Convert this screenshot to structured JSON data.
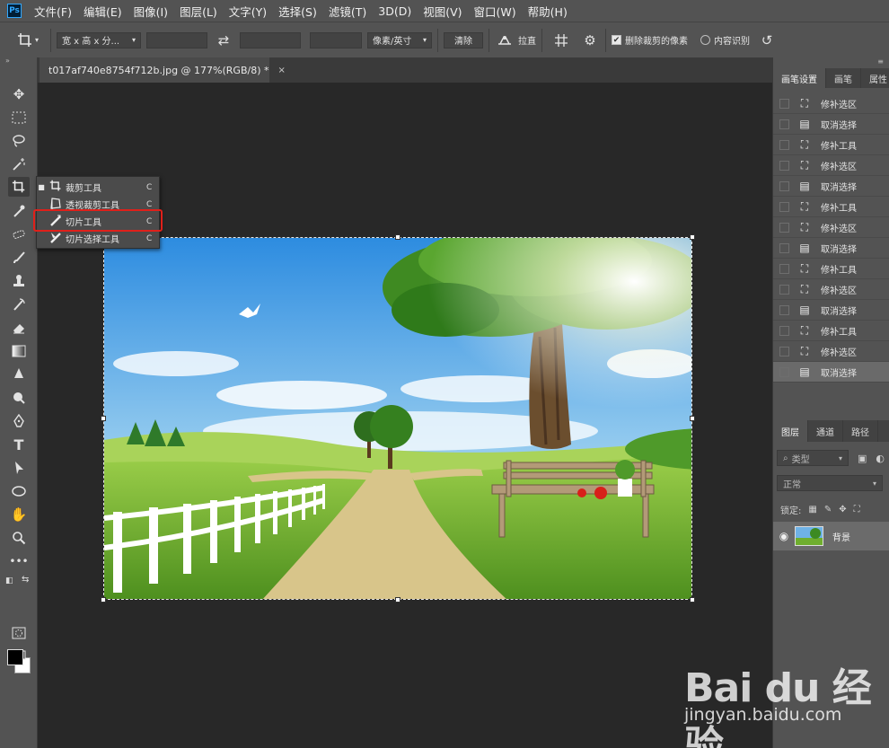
{
  "app": {
    "logo": "Ps"
  },
  "menu": [
    "文件(F)",
    "编辑(E)",
    "图像(I)",
    "图层(L)",
    "文字(Y)",
    "选择(S)",
    "滤镜(T)",
    "3D(D)",
    "视图(V)",
    "窗口(W)",
    "帮助(H)"
  ],
  "options": {
    "ratio_preset": "宽 x 高 x 分...",
    "resolution_unit": "像素/英寸",
    "clear_label": "清除",
    "straighten_label": "拉直",
    "delete_cropped_label": "删除裁剪的像素",
    "delete_cropped_checked": true,
    "content_aware_label": "内容识别",
    "content_aware_checked": false
  },
  "document": {
    "tab_title": "t017af740e8754f712b.jpg @ 177%(RGB/8) *",
    "close": "×"
  },
  "flyout": {
    "items": [
      {
        "label": "裁剪工具",
        "shortcut": "C",
        "current": true
      },
      {
        "label": "透视裁剪工具",
        "shortcut": "C",
        "current": false
      },
      {
        "label": "切片工具",
        "shortcut": "C",
        "current": false
      },
      {
        "label": "切片选择工具",
        "shortcut": "C",
        "current": false
      }
    ],
    "highlighted_index": 2
  },
  "right_panel": {
    "top_tabs": [
      "画笔设置",
      "画笔",
      "属性"
    ],
    "history": [
      {
        "label": "修补选区",
        "icon": "patch-selection-icon"
      },
      {
        "label": "取消选择",
        "icon": "document-icon"
      },
      {
        "label": "修补工具",
        "icon": "patch-selection-icon"
      },
      {
        "label": "修补选区",
        "icon": "patch-selection-icon"
      },
      {
        "label": "取消选择",
        "icon": "document-icon"
      },
      {
        "label": "修补工具",
        "icon": "patch-selection-icon"
      },
      {
        "label": "修补选区",
        "icon": "patch-selection-icon"
      },
      {
        "label": "取消选择",
        "icon": "document-icon"
      },
      {
        "label": "修补工具",
        "icon": "patch-selection-icon"
      },
      {
        "label": "修补选区",
        "icon": "patch-selection-icon"
      },
      {
        "label": "取消选择",
        "icon": "document-icon"
      },
      {
        "label": "修补工具",
        "icon": "patch-selection-icon"
      },
      {
        "label": "修补选区",
        "icon": "patch-selection-icon"
      },
      {
        "label": "取消选择",
        "icon": "document-icon"
      }
    ],
    "history_selected_index": 13,
    "layer_tabs": [
      "图层",
      "通道",
      "路径"
    ],
    "filter_type": "类型",
    "blend_mode": "正常",
    "lock_label": "锁定:",
    "layers": [
      {
        "name": "背景"
      }
    ]
  },
  "watermark": {
    "main": "Bai du 经验",
    "sub": "jingyan.baidu.com"
  }
}
